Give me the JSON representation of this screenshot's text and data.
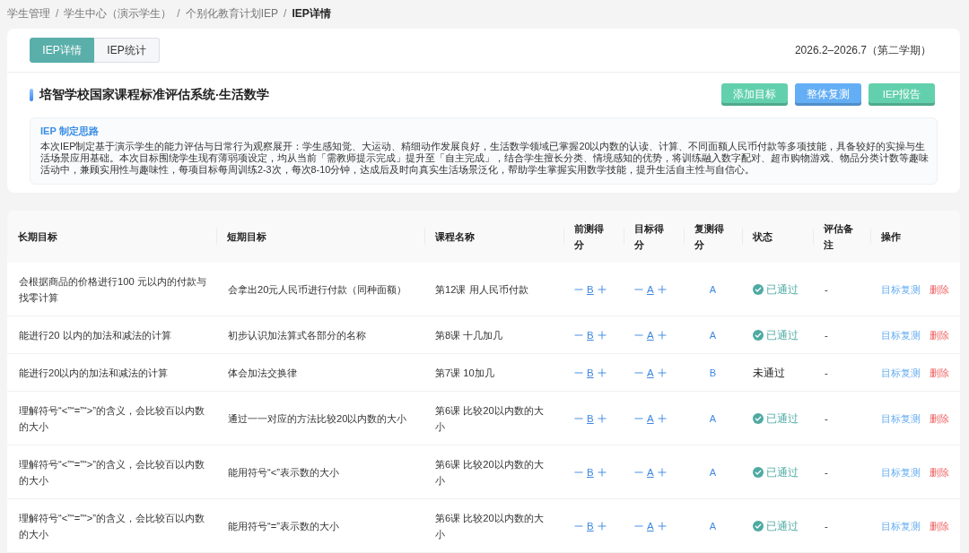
{
  "breadcrumb": {
    "items": [
      {
        "label": "学生管理",
        "current": false
      },
      {
        "label": "学生中心（演示学生）",
        "current": false
      },
      {
        "label": "个别化教育计划IEP",
        "current": false
      },
      {
        "label": "IEP详情",
        "current": true
      }
    ],
    "separators": [
      "/",
      "/",
      "/"
    ]
  },
  "tabs": [
    {
      "label": "IEP详情",
      "selected": true
    },
    {
      "label": "IEP统计",
      "selected": false
    }
  ],
  "term": "2026.2–2026.7（第二学期）",
  "plan": {
    "title": "培智学校国家课程标准评估系统·生活数学",
    "buttons": [
      {
        "label": "添加目标",
        "color": "#62d0ac"
      },
      {
        "label": "整体复测",
        "color": "#64aef5"
      },
      {
        "label": "IEP报告",
        "color": "#62d0ac"
      }
    ]
  },
  "rationale": {
    "title": "IEP 制定思路",
    "text": "本次IEP制定基于演示学生的能力评估与日常行为观察展开：学生感知觉、大运动、精细动作发展良好，生活数学领域已掌握20以内数的认读、计算、不同面额人民币付款等多项技能，具备较好的实操与生活场景应用基础。本次目标围绕学生现有薄弱项设定，均从当前「需教师提示完成」提升至「自主完成」，结合学生擅长分类、情境感知的优势，将训练融入数字配对、超市购物游戏、物品分类计数等趣味活动中，兼顾实用性与趣味性，每项目标每周训练2-3次，每次8-10分钟，达成后及时向真实生活场景泛化，帮助学生掌握实用数学技能，提升生活自主性与自信心。"
  },
  "table": {
    "columns": [
      "长期目标",
      "短期目标",
      "课程名称",
      "前测得分",
      "目标得分",
      "复测得分",
      "状态",
      "评估备注",
      "操作"
    ],
    "rows": [
      {
        "long_goal": "会根据商品的价格进行100 元以内的付款与找零计算",
        "short_goal": "会拿出20元人民币进行付款（同种面额）",
        "course": "第12课 用人民币付款",
        "pre_score": "B",
        "target_score": "A",
        "retest_score": "A",
        "status": {
          "label": "已通过",
          "passed": true
        },
        "note": "-",
        "actions": [
          {
            "label": "目标复测",
            "kind": "retest"
          },
          {
            "label": "删除",
            "kind": "delete"
          }
        ]
      },
      {
        "long_goal": "能进行20 以内的加法和减法的计算",
        "short_goal": "初步认识加法算式各部分的名称",
        "course": "第8课 十几加几",
        "pre_score": "B",
        "target_score": "A",
        "retest_score": "A",
        "status": {
          "label": "已通过",
          "passed": true
        },
        "note": "-",
        "actions": [
          {
            "label": "目标复测",
            "kind": "retest"
          },
          {
            "label": "删除",
            "kind": "delete"
          }
        ]
      },
      {
        "long_goal": "能进行20以内的加法和减法的计算",
        "short_goal": "体会加法交换律",
        "course": "第7课 10加几",
        "pre_score": "B",
        "target_score": "A",
        "retest_score": "B",
        "status": {
          "label": "未通过",
          "passed": false
        },
        "note": "-",
        "actions": [
          {
            "label": "目标复测",
            "kind": "retest"
          },
          {
            "label": "删除",
            "kind": "delete"
          }
        ]
      },
      {
        "long_goal": "理解符号“<”“=”“>”的含义，会比较百以内数的大小",
        "short_goal": "通过一一对应的方法比较20以内数的大小",
        "course": "第6课 比较20以内数的大小",
        "pre_score": "B",
        "target_score": "A",
        "retest_score": "A",
        "status": {
          "label": "已通过",
          "passed": true
        },
        "note": "-",
        "actions": [
          {
            "label": "目标复测",
            "kind": "retest"
          },
          {
            "label": "删除",
            "kind": "delete"
          }
        ]
      },
      {
        "long_goal": "理解符号“<”“=”“>”的含义，会比较百以内数的大小",
        "short_goal": "能用符号“<”表示数的大小",
        "course": "第6课 比较20以内数的大小",
        "pre_score": "B",
        "target_score": "A",
        "retest_score": "A",
        "status": {
          "label": "已通过",
          "passed": true
        },
        "note": "-",
        "actions": [
          {
            "label": "目标复测",
            "kind": "retest"
          },
          {
            "label": "删除",
            "kind": "delete"
          }
        ]
      },
      {
        "long_goal": "理解符号“<”“=”“>”的含义，会比较百以内数的大小",
        "short_goal": "能用符号“=”表示数的大小",
        "course": "第6课 比较20以内数的大小",
        "pre_score": "B",
        "target_score": "A",
        "retest_score": "A",
        "status": {
          "label": "已通过",
          "passed": true
        },
        "note": "-",
        "actions": [
          {
            "label": "目标复测",
            "kind": "retest"
          },
          {
            "label": "删除",
            "kind": "delete"
          }
        ]
      }
    ]
  }
}
